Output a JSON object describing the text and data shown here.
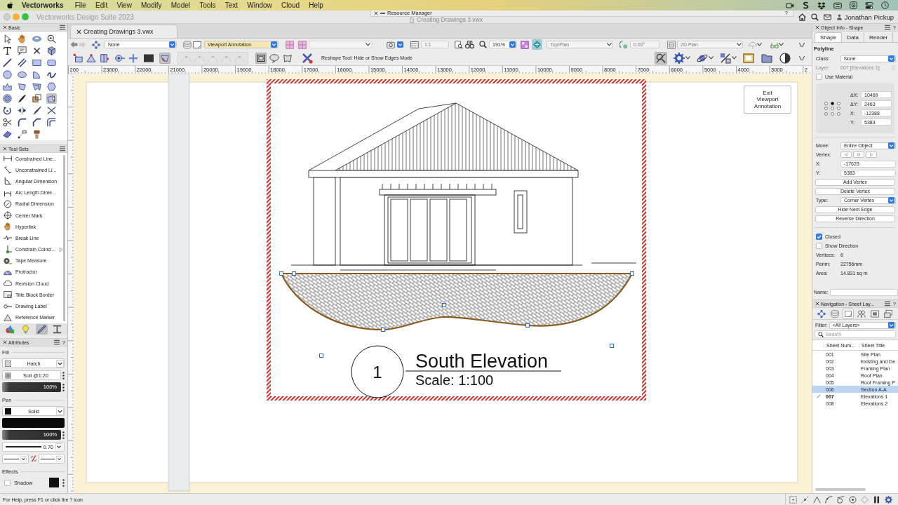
{
  "menu_bar": {
    "app": "Vectorworks",
    "menus": [
      "File",
      "Edit",
      "View",
      "Modify",
      "Model",
      "Tools",
      "Text",
      "Window",
      "Cloud",
      "Help"
    ]
  },
  "title_bar": {
    "title": "Vectorworks Design Suite 2023",
    "document": "Creating Drawings 3.vwx",
    "user": "Jonathan Pickup"
  },
  "resource_manager": {
    "title": "Resource Manager",
    "help": "?"
  },
  "basic_palette": {
    "title": "Basic",
    "tools": [
      {
        "selected": false
      },
      {
        "selected": false
      },
      {
        "selected": false
      },
      {
        "selected": false
      },
      {
        "selected": false
      },
      {
        "selected": false
      },
      {
        "selected": false
      },
      {
        "selected": false
      },
      {
        "selected": false
      },
      {
        "selected": false
      },
      {
        "selected": false
      },
      {
        "selected": false
      },
      {
        "selected": false
      },
      {
        "selected": false
      },
      {
        "selected": false
      },
      {
        "selected": false
      },
      {
        "selected": false
      },
      {
        "selected": false
      },
      {
        "selected": false
      },
      {
        "selected": false
      },
      {
        "selected": false
      },
      {
        "selected": false
      },
      {
        "selected": false
      },
      {
        "selected": true
      },
      {
        "selected": false
      },
      {
        "selected": false
      },
      {
        "selected": false
      },
      {
        "selected": false
      },
      {
        "selected": false
      },
      {
        "selected": false
      },
      {
        "selected": false
      },
      {
        "selected": false
      },
      {
        "selected": false
      },
      {
        "selected": false
      },
      {
        "selected": false
      }
    ]
  },
  "tool_sets": {
    "title": "Tool Sets",
    "items": [
      "Constrained Line...",
      "Unconstrained Li...",
      "Angular Dimension",
      "Arc Length Dime...",
      "Radial Dimension",
      "Center Mark",
      "Hyperlink",
      "Break Line",
      "Constrain Coinci...",
      "Tape Measure",
      "Protractor",
      "Revision Cloud",
      "Title Block Border",
      "Drawing Label",
      "Reference Marker"
    ],
    "tabs": [
      {
        "selected": false
      },
      {
        "selected": false
      },
      {
        "selected": true
      },
      {
        "selected": false
      }
    ]
  },
  "attributes": {
    "title": "Attributes",
    "help": "?",
    "fill": {
      "label": "Fill",
      "style": "Hatch",
      "hatch": "Soil @1:20",
      "opacity": "100%"
    },
    "pen": {
      "label": "Pen",
      "style": "Solid",
      "opacity": "100%",
      "weight": "0.70"
    },
    "effects": {
      "label": "Effects",
      "shadow": {
        "label": "Shadow",
        "checked": false
      }
    }
  },
  "document_tab": {
    "title": "Creating Drawings 3.vwx"
  },
  "view_bar": {
    "class": {
      "value": "None",
      "disabled": false,
      "highlighted": false
    },
    "layer": {
      "value": "Viewport Annotation",
      "disabled": false,
      "highlighted": true
    },
    "scale": {
      "value": "1:1",
      "disabled": true
    },
    "zoom": {
      "value": "191%",
      "disabled": false
    },
    "view": {
      "value": "Top/Plan",
      "disabled": true
    },
    "rotation": {
      "value": "0.00°",
      "disabled": true
    },
    "render_mode": {
      "value": "2D Plan",
      "disabled": true
    }
  },
  "mode_bar": {
    "modes": [
      {
        "selected": false
      },
      {
        "selected": false
      },
      {
        "selected": false
      },
      {
        "selected": false
      },
      {
        "selected": false
      },
      {
        "selected": false
      },
      {
        "selected": true
      }
    ],
    "vertex_tools": [
      {
        "disabled": true
      },
      {
        "disabled": true
      },
      {
        "disabled": true
      },
      {
        "disabled": true
      },
      {
        "disabled": true
      }
    ],
    "edge_modes": [
      {
        "selected": true
      },
      {
        "selected": false
      },
      {
        "selected": false
      }
    ],
    "hint": "Reshape Tool: Hide or Show Edges Mode",
    "snaps": [
      {
        "selected": true
      },
      {
        "selected": false
      },
      {
        "selected": false
      },
      {
        "selected": false
      },
      {
        "selected": false
      },
      {
        "selected": false
      },
      {
        "selected": false
      }
    ]
  },
  "rulers": {
    "horizontal": [
      "200",
      "23000",
      "22000",
      "21000",
      "20000",
      "19000",
      "18000",
      "17000",
      "16000",
      "15000",
      "14000",
      "13000",
      "12000",
      "11000",
      "10000",
      "9000",
      "8000",
      "7000",
      "6000",
      "5000",
      "4000",
      "3000",
      "2"
    ]
  },
  "canvas": {
    "exit_button": "Exit Viewport Annotation",
    "drawing_label": {
      "number": "1",
      "title": "South Elevation",
      "scale": "Scale: 1:100"
    }
  },
  "object_info": {
    "title": "Object Info - Shape",
    "help": "?",
    "tabs": [
      {
        "label": "Shape",
        "selected": true
      },
      {
        "label": "Data",
        "selected": false
      },
      {
        "label": "Render",
        "selected": false
      }
    ],
    "object_type": "Polyline",
    "class": {
      "label": "Class:",
      "value": "None"
    },
    "layer": {
      "label": "Layer:",
      "value": "007 [Elevations 1]",
      "disabled": true
    },
    "use_material": {
      "label": "Use Material",
      "checked": false
    },
    "anchor_points": [
      {
        "selected": false
      },
      {
        "selected": true
      },
      {
        "selected": false
      },
      {
        "selected": false
      },
      {
        "selected": false
      },
      {
        "selected": false
      },
      {
        "selected": false
      },
      {
        "selected": false
      },
      {
        "selected": false
      }
    ],
    "geometry": [
      {
        "label": "ΔX:",
        "value": "10469"
      },
      {
        "label": "ΔY:",
        "value": "2463"
      },
      {
        "label": "X:",
        "value": "-12388"
      },
      {
        "label": "Y:",
        "value": "5383"
      }
    ],
    "move": {
      "label": "Move:",
      "value": "Entire Object"
    },
    "vertex_label": "Vertex:",
    "vertex": [
      {
        "label": "X:",
        "value": "-17623"
      },
      {
        "label": "Y:",
        "value": "5383"
      }
    ],
    "vertex_buttons": [
      "Add Vertex",
      "Delete Vertex"
    ],
    "type": {
      "label": "Type:",
      "value": "Corner Vertex"
    },
    "edge_buttons": [
      "Hide Next Edge",
      "Reverse Direction"
    ],
    "options": [
      {
        "label": "Closed",
        "checked": true
      },
      {
        "label": "Show Direction",
        "checked": false
      }
    ],
    "info": [
      {
        "label": "Vertices:",
        "value": "6"
      },
      {
        "label": "Perim:",
        "value": "22756mm"
      },
      {
        "label": "Area:",
        "value": "14.831 sq m"
      }
    ],
    "name_label": "Name:"
  },
  "navigation": {
    "title": "Navigation - Sheet Lay...",
    "help": "?",
    "tabs": [
      {
        "selected": false
      },
      {
        "selected": false
      },
      {
        "selected": true
      },
      {
        "selected": false
      },
      {
        "selected": false
      },
      {
        "selected": false
      }
    ],
    "filter_label": "Filter:",
    "filter": "<All Layers>",
    "search_placeholder": "Search",
    "columns": [
      "Sheet Num...",
      "Sheet Title"
    ],
    "rows": [
      {
        "number": "001",
        "title": "Site Plan",
        "selected": false,
        "active": false
      },
      {
        "number": "002",
        "title": "Existing and De",
        "selected": false,
        "active": false
      },
      {
        "number": "003",
        "title": "Framing Plan",
        "selected": false,
        "active": false
      },
      {
        "number": "004",
        "title": "Roof Plan",
        "selected": false,
        "active": false
      },
      {
        "number": "005",
        "title": "Roof Framing P",
        "selected": false,
        "active": false
      },
      {
        "number": "006",
        "title": "Section A-A",
        "selected": true,
        "active": false
      },
      {
        "number": "007",
        "title": "Elevations 1",
        "selected": false,
        "active": true
      },
      {
        "number": "008",
        "title": "Elevations 2",
        "selected": false,
        "active": false
      }
    ]
  },
  "status_bar": {
    "help": "For Help, press F1 or click the ? icon"
  }
}
